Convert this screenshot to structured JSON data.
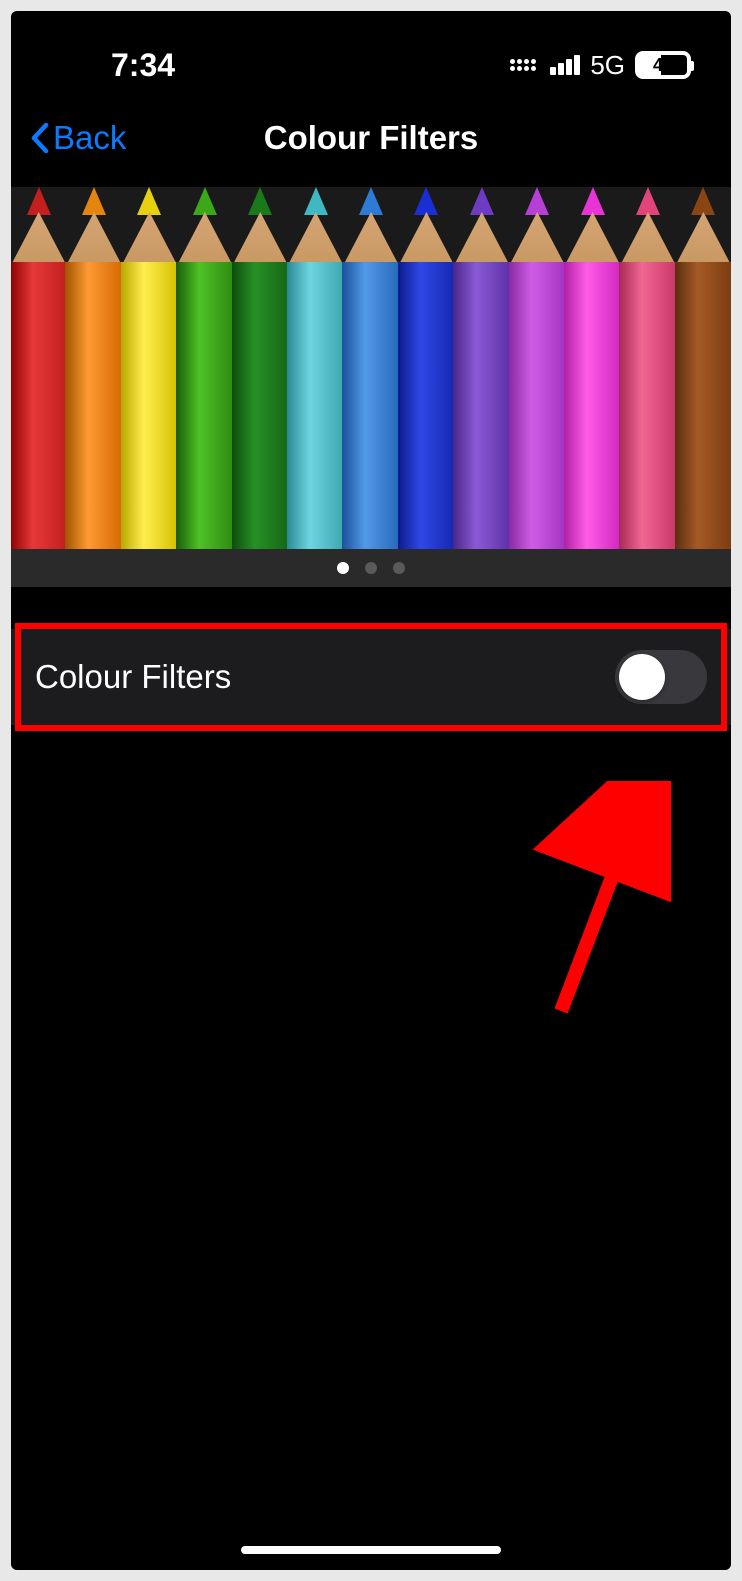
{
  "status_bar": {
    "time": "7:34",
    "network_type": "5G",
    "battery_percent": "46"
  },
  "nav": {
    "back_label": "Back",
    "title": "Colour Filters"
  },
  "preview": {
    "pencils": [
      {
        "tip": "#c41e1e",
        "body": "linear-gradient(90deg, #8b0000 0%, #e63939 40%, #c21e1e 100%)"
      },
      {
        "tip": "#e6850e",
        "body": "linear-gradient(90deg, #a05500 0%, #ff9933 40%, #d46800 100%)"
      },
      {
        "tip": "#e6d010",
        "body": "linear-gradient(90deg, #b8a800 0%, #ffed4e 40%, #d4c000 100%)"
      },
      {
        "tip": "#3ca818",
        "body": "linear-gradient(90deg, #1a5c08 0%, #4ec226 40%, #2d8a12 100%)"
      },
      {
        "tip": "#1a7a1a",
        "body": "linear-gradient(90deg, #0d4d0d 0%, #269126 40%, #156615 100%)"
      },
      {
        "tip": "#3fb8c4",
        "body": "linear-gradient(90deg, #2a8a94 0%, #6dd5e0 40%, #3ba5b0 100%)"
      },
      {
        "tip": "#2e7bd6",
        "body": "linear-gradient(90deg, #1a5299 0%, #5299e8 40%, #2668b8 100%)"
      },
      {
        "tip": "#1a2ed6",
        "body": "linear-gradient(90deg, #0d1a8a 0%, #3048e8 40%, #1526b0 100%)"
      },
      {
        "tip": "#6e3cc4",
        "body": "linear-gradient(90deg, #4a2688 0%, #8a5ad6 40%, #5c30a8 100%)"
      },
      {
        "tip": "#b83fd6",
        "body": "linear-gradient(90deg, #8a2aa3 0%, #d05ce6 40%, #a333c0 100%)"
      },
      {
        "tip": "#e833d6",
        "body": "linear-gradient(90deg, #b020a3 0%, #ff5ce8 40%, #d026c0 100%)"
      },
      {
        "tip": "#e0447a",
        "body": "linear-gradient(90deg, #a82a56 0%, #f26694 40%, #c83668 100%)"
      },
      {
        "tip": "#8b4513",
        "body": "linear-gradient(90deg, #5c2e0d 0%, #a65a26 40%, #7a3c10 100%)"
      }
    ],
    "page_count": 3,
    "active_page": 0
  },
  "settings": {
    "colour_filters_label": "Colour Filters",
    "colour_filters_enabled": false
  },
  "annotation": {
    "has_highlight": true,
    "has_arrow": true
  }
}
